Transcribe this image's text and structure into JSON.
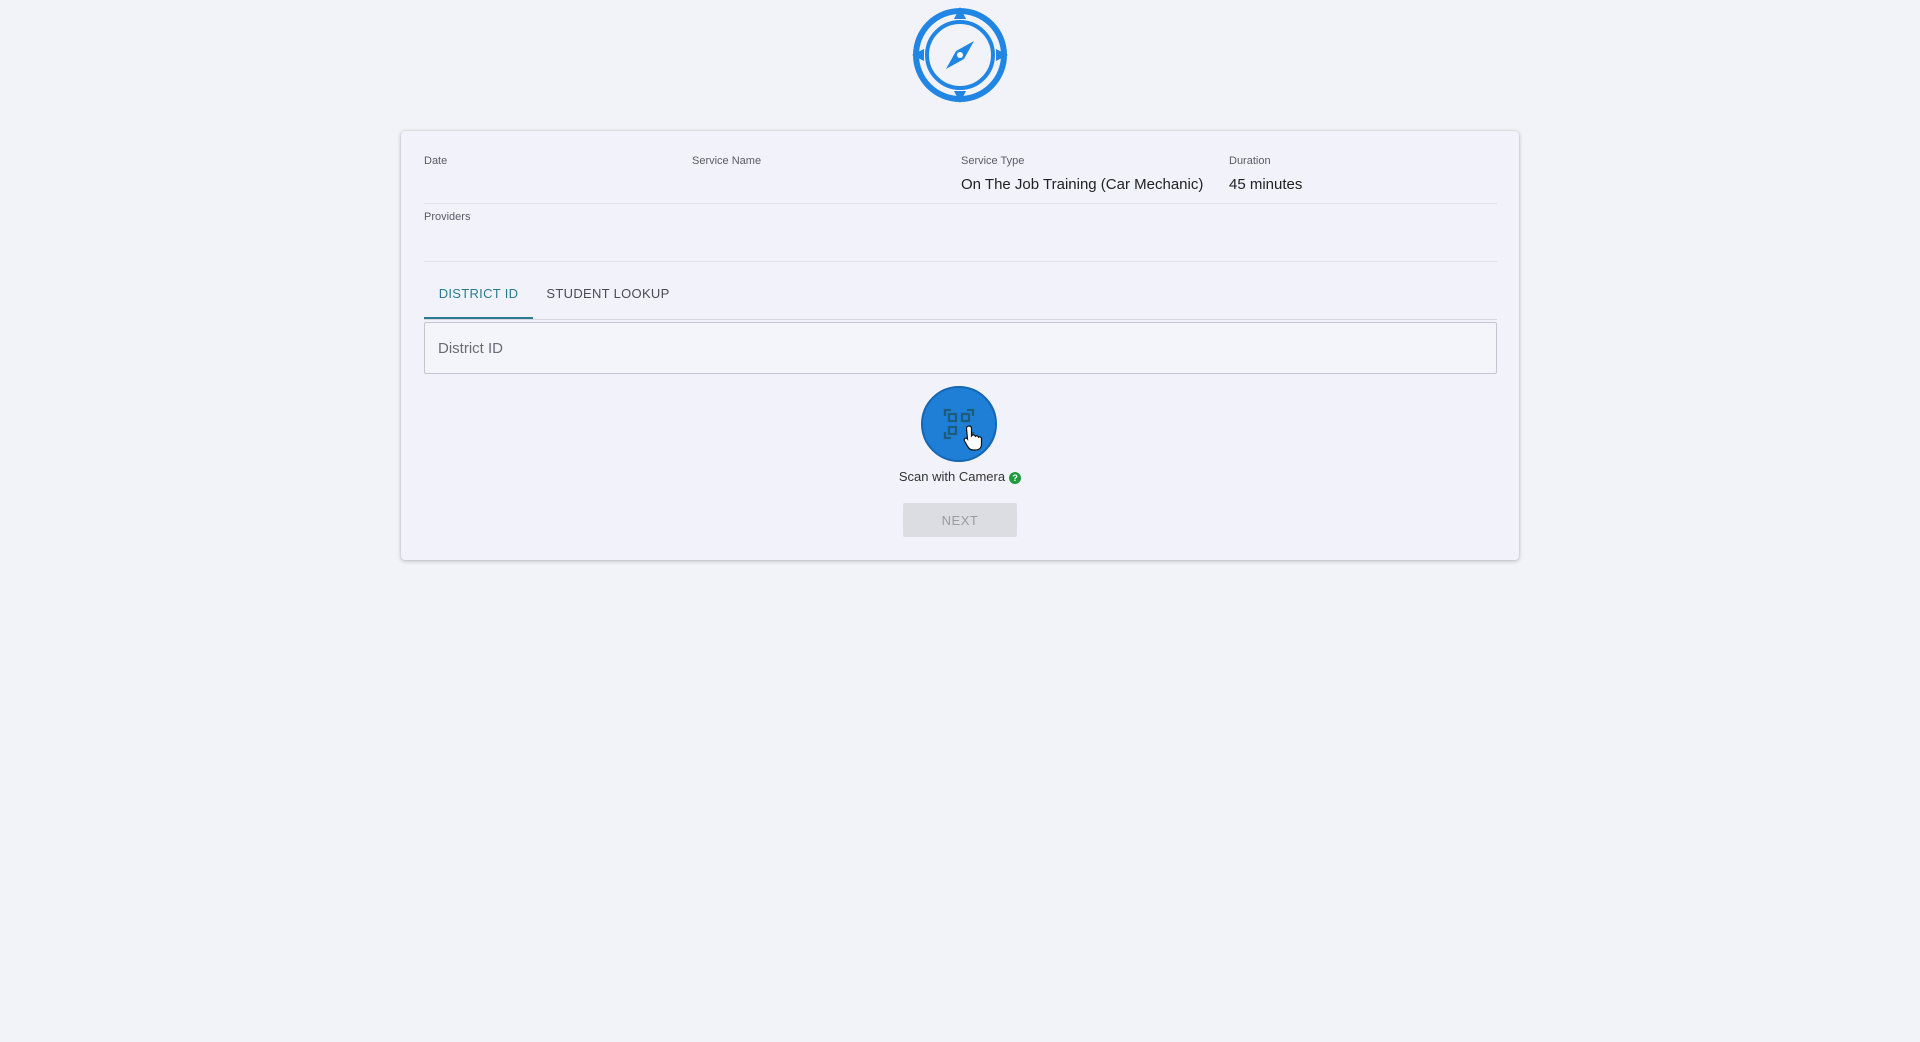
{
  "info": {
    "date_label": "Date",
    "date_value": "",
    "service_name_label": "Service Name",
    "service_name_value": "",
    "service_type_label": "Service Type",
    "service_type_value": "On The Job Training (Car Mechanic)",
    "duration_label": "Duration",
    "duration_value": "45 minutes",
    "providers_label": "Providers",
    "providers_value": ""
  },
  "tabs": [
    {
      "label": "DISTRICT ID",
      "active": true
    },
    {
      "label": "STUDENT LOOKUP",
      "active": false
    }
  ],
  "district_input": {
    "placeholder": "District ID",
    "value": ""
  },
  "scan": {
    "caption": "Scan with Camera",
    "help_glyph": "?"
  },
  "next_button": {
    "label": "NEXT",
    "disabled": true
  },
  "colors": {
    "accent": "#2b7a92",
    "brand_blue": "#1f7ed6",
    "help_green": "#1e9b3c"
  },
  "icons": {
    "logo": "compass-icon",
    "scan": "qr-scan-icon",
    "help": "help-circle-icon",
    "cursor": "hand-pointer-cursor-icon"
  }
}
